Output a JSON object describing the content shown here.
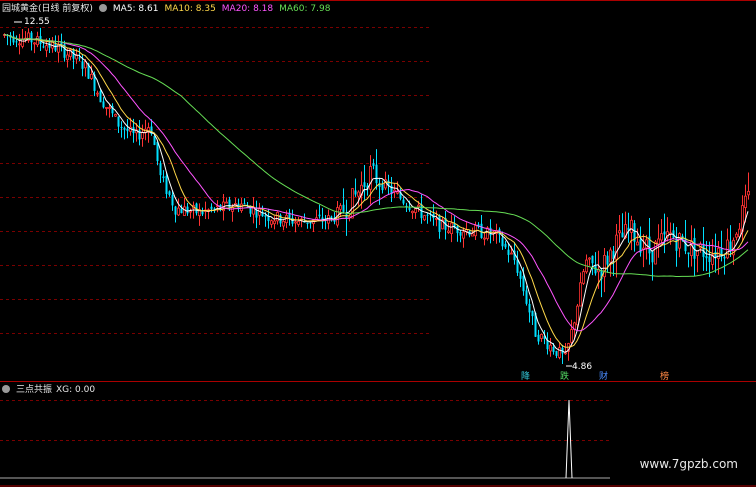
{
  "upper_panel": {
    "title": "园城黄金(日线 前复权)",
    "indicators": [
      {
        "label": "MA5: 8.61",
        "color": "#ffffff"
      },
      {
        "label": "MA10: 8.35",
        "color": "#ffd84a"
      },
      {
        "label": "MA20: 8.18",
        "color": "#ff55ff"
      },
      {
        "label": "MA60: 7.98",
        "color": "#66dd55"
      }
    ],
    "high_label": "12.55",
    "low_label": "4.86",
    "event_tags": [
      {
        "text": "降",
        "color": "#33ccdd"
      },
      {
        "text": "跌",
        "color": "#55dd66"
      },
      {
        "text": "财",
        "color": "#4a8cff"
      },
      {
        "text": "榜",
        "color": "#ff8844"
      }
    ]
  },
  "lower_panel": {
    "title": "三点共振",
    "indicator": "XG: 0.00",
    "signal_color": "#ffffff"
  },
  "watermark": "www.7gpzb.com",
  "colors": {
    "up": "#ff3333",
    "down": "#00e0ff",
    "grid": "#7a0000",
    "border": "#aa0000",
    "ma5": "#ffffff",
    "ma10": "#ffd84a",
    "ma20": "#ff55ff",
    "ma60": "#66dd55"
  }
}
